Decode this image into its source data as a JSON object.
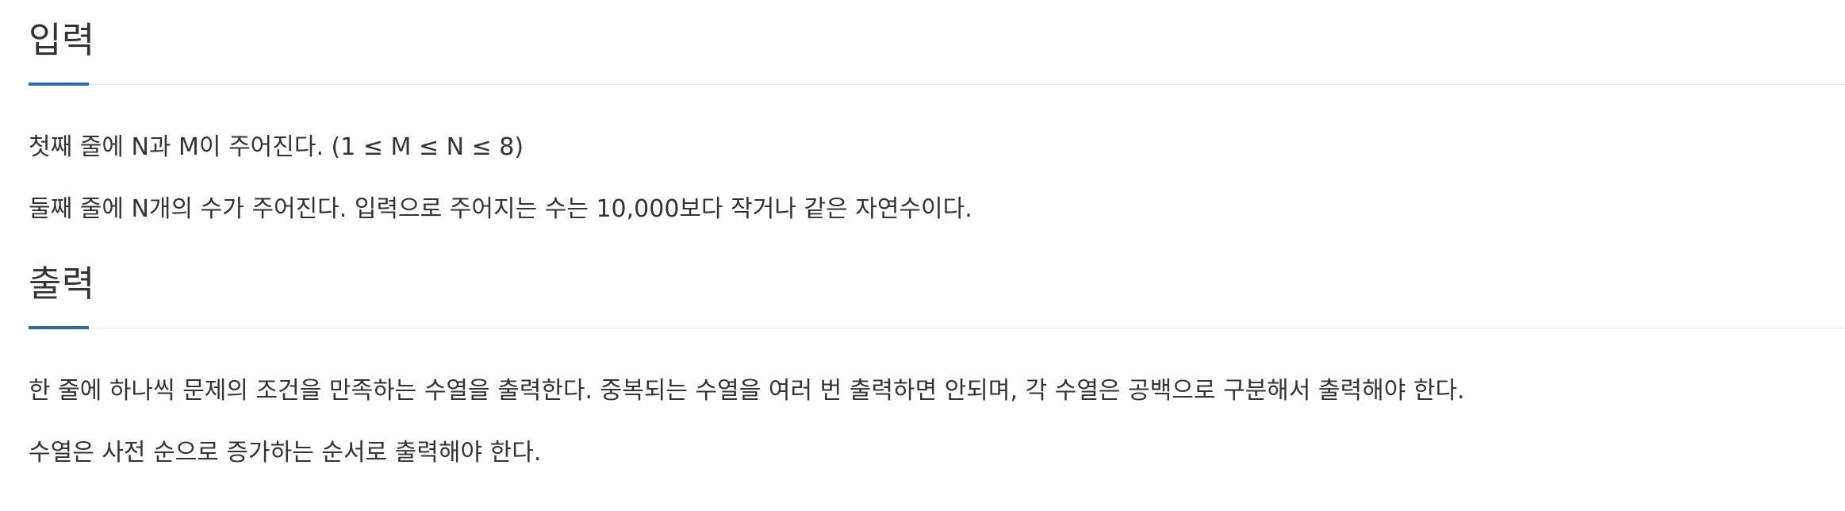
{
  "input_section": {
    "heading": "입력",
    "paragraphs": [
      "첫째 줄에 N과 M이 주어진다. (1 ≤ M ≤ N ≤ 8)",
      "둘째 줄에 N개의 수가 주어진다. 입력으로 주어지는 수는 10,000보다 작거나 같은 자연수이다."
    ]
  },
  "output_section": {
    "heading": "출력",
    "paragraphs": [
      "한 줄에 하나씩 문제의 조건을 만족하는 수열을 출력한다. 중복되는 수열을 여러 번 출력하면 안되며, 각 수열은 공백으로 구분해서 출력해야 한다.",
      "수열은 사전 순으로 증가하는 순서로 출력해야 한다."
    ]
  },
  "colors": {
    "heading_underline": "#2e6aa6",
    "text": "#333333",
    "divider": "#e6e6e6"
  }
}
